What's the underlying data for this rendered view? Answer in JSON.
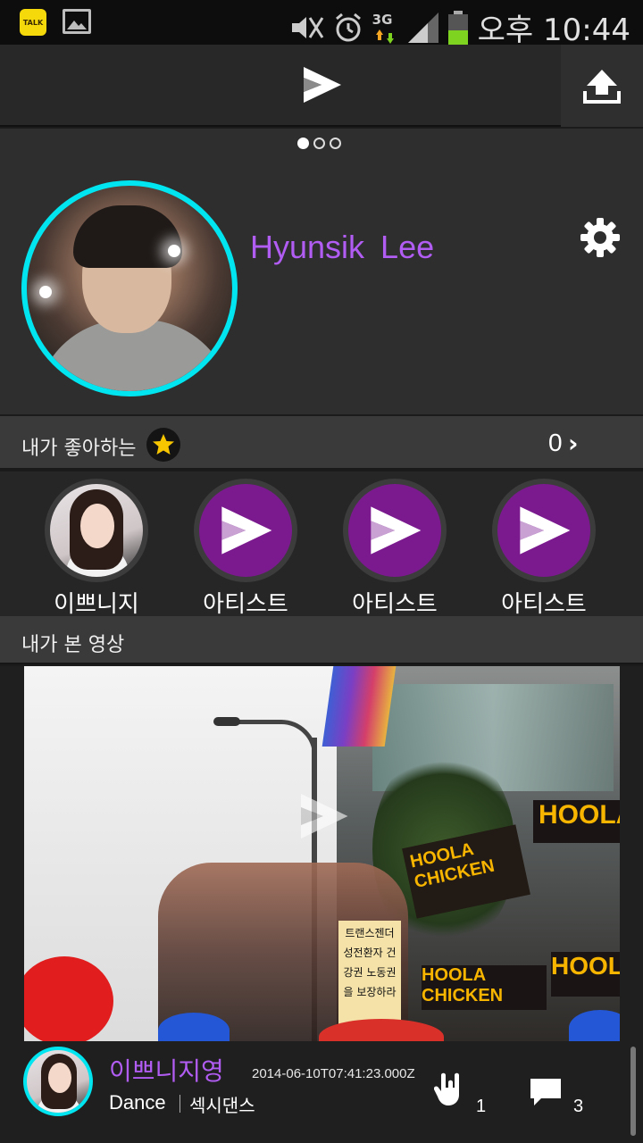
{
  "status_bar": {
    "time": "오후 10:44",
    "network": "3G",
    "talk_label": "TALK"
  },
  "header": {
    "logo_icon": "play-logo-icon",
    "upload_icon": "upload-icon"
  },
  "profile": {
    "name": "Hyunsik  Lee",
    "page_indicator": {
      "count": 3,
      "active": 0
    },
    "settings_icon": "gear-icon",
    "avatar_ring_color": "#00e5ef",
    "name_color": "#b15cf2"
  },
  "favorites": {
    "title": "내가 좋아하는",
    "count": "0",
    "chevron": "›",
    "items": [
      {
        "label": "이쁘니지",
        "type": "photo"
      },
      {
        "label": "아티스트",
        "type": "logo"
      },
      {
        "label": "아티스트",
        "type": "logo"
      },
      {
        "label": "아티스트",
        "type": "logo"
      }
    ]
  },
  "watched": {
    "title": "내가 본 영상",
    "video": {
      "uploader": "이쁘니지영",
      "date": "2014-06-10T07:41:23.000Z",
      "category": "Dance",
      "style": "섹시댄스",
      "likes": "1",
      "comments": "3",
      "thumb_sign_hoola": "HOOLA",
      "thumb_sign_chicken": "HOOLA CHICKEN",
      "thumb_sign_korean": "트랜스젠더 성전환자 건강권 노동권을 보장하라"
    }
  },
  "colors": {
    "accent_purple": "#b15cf2",
    "ring_cyan": "#00e5ef",
    "logo_purple": "#7b1a8f"
  }
}
